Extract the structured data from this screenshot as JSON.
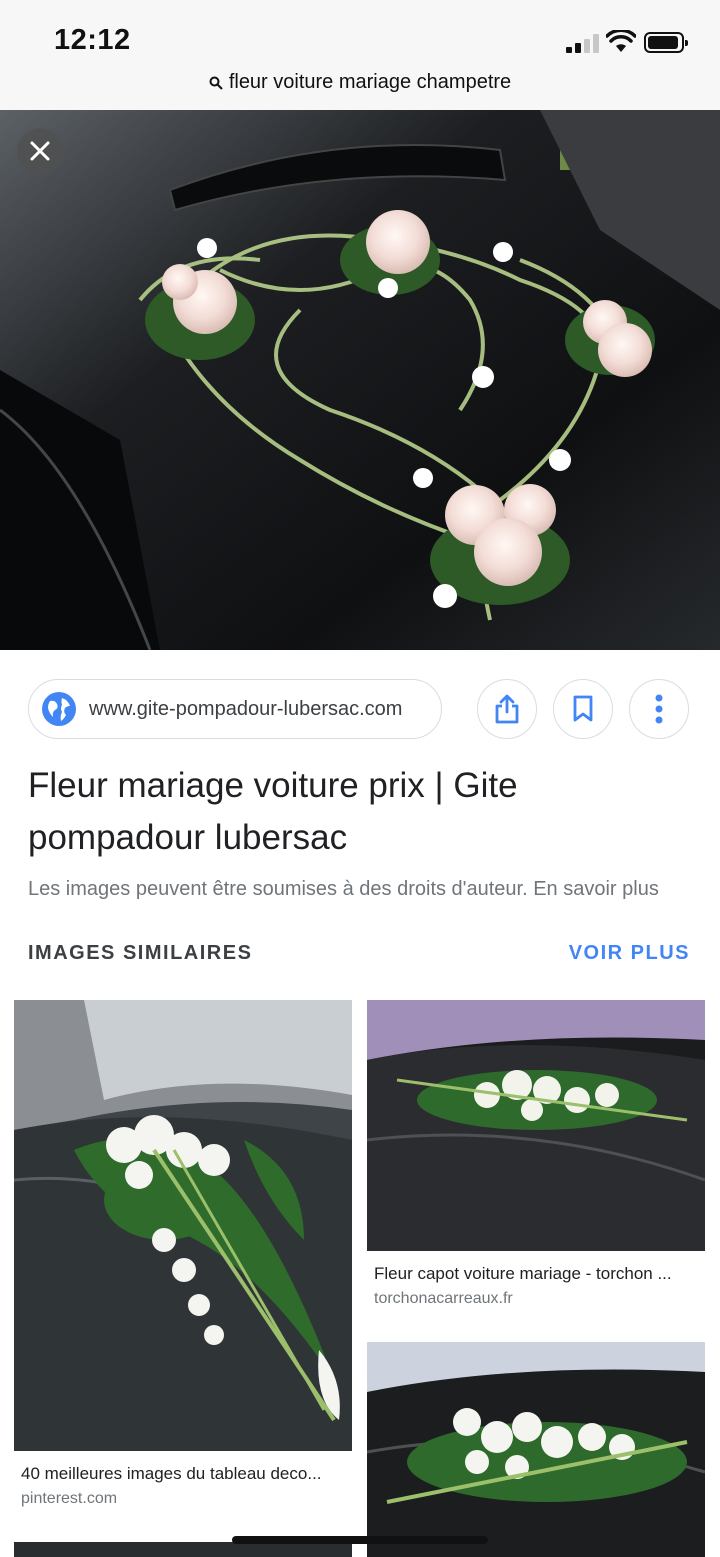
{
  "status": {
    "time": "12:12"
  },
  "url_bar": {
    "query": "fleur voiture mariage champetre"
  },
  "result": {
    "source_domain": "www.gite-pompadour-lubersac.com",
    "title": "Fleur mariage voiture prix | Gite pompadour lubersac",
    "copyright": "Les images peuvent être soumises à des droits d'auteur. En savoir plus"
  },
  "similar": {
    "heading": "IMAGES SIMILAIRES",
    "more": "VOIR PLUS",
    "items": [
      {
        "title": "40 meilleures images du tableau deco...",
        "source": "pinterest.com"
      },
      {
        "title": "Fleur capot voiture mariage - torchon ...",
        "source": "torchonacarreaux.fr"
      }
    ]
  },
  "icons": {
    "search": "search-icon",
    "close": "close-icon",
    "globe": "globe-icon",
    "share": "share-icon",
    "bookmark": "bookmark-icon",
    "more": "more-vert-icon"
  },
  "colors": {
    "accent": "#4285f4",
    "status_bg": "#f7f7f7"
  }
}
